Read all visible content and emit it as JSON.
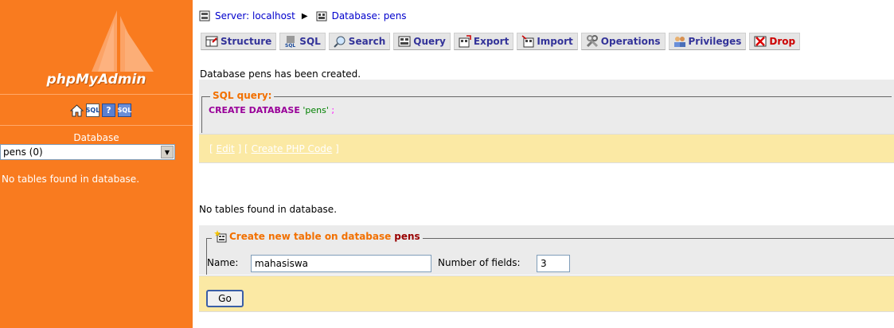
{
  "app": {
    "logo_text": "phpMyAdmin"
  },
  "sidebar": {
    "icons": [
      "home-icon",
      "sql-icon",
      "help-icon",
      "sql-window-icon"
    ],
    "database_label": "Database",
    "database_selected": "pens (0)",
    "message": "No tables found in database."
  },
  "breadcrumb": {
    "server": "Server: localhost",
    "database": "Database: pens"
  },
  "tabs": [
    {
      "label": "Structure",
      "icon": "structure-icon"
    },
    {
      "label": "SQL",
      "icon": "sql-icon"
    },
    {
      "label": "Search",
      "icon": "search-icon"
    },
    {
      "label": "Query",
      "icon": "query-icon"
    },
    {
      "label": "Export",
      "icon": "export-icon"
    },
    {
      "label": "Import",
      "icon": "import-icon"
    },
    {
      "label": "Operations",
      "icon": "operations-icon"
    },
    {
      "label": "Privileges",
      "icon": "privileges-icon"
    },
    {
      "label": "Drop",
      "icon": "drop-icon"
    }
  ],
  "main": {
    "created_message": "Database pens has been created.",
    "sql_legend": "SQL query:",
    "sql_keyword": "CREATE DATABASE",
    "sql_string": "'pens'",
    "sql_end": ";",
    "edit_link": "Edit",
    "create_php_link": "Create PHP Code",
    "no_tables_message": "No tables found in database.",
    "create_table": {
      "legend_prefix": "Create new table on database",
      "database_name": "pens",
      "name_label": "Name:",
      "name_value": "mahasiswa",
      "fields_label": "Number of fields:",
      "fields_value": "3",
      "go_label": "Go"
    }
  },
  "colors": {
    "sidebar_bg": "#f97b1f",
    "legend": "#f27000",
    "action_bar": "#fbe9a4",
    "tab_text": "#333399"
  }
}
